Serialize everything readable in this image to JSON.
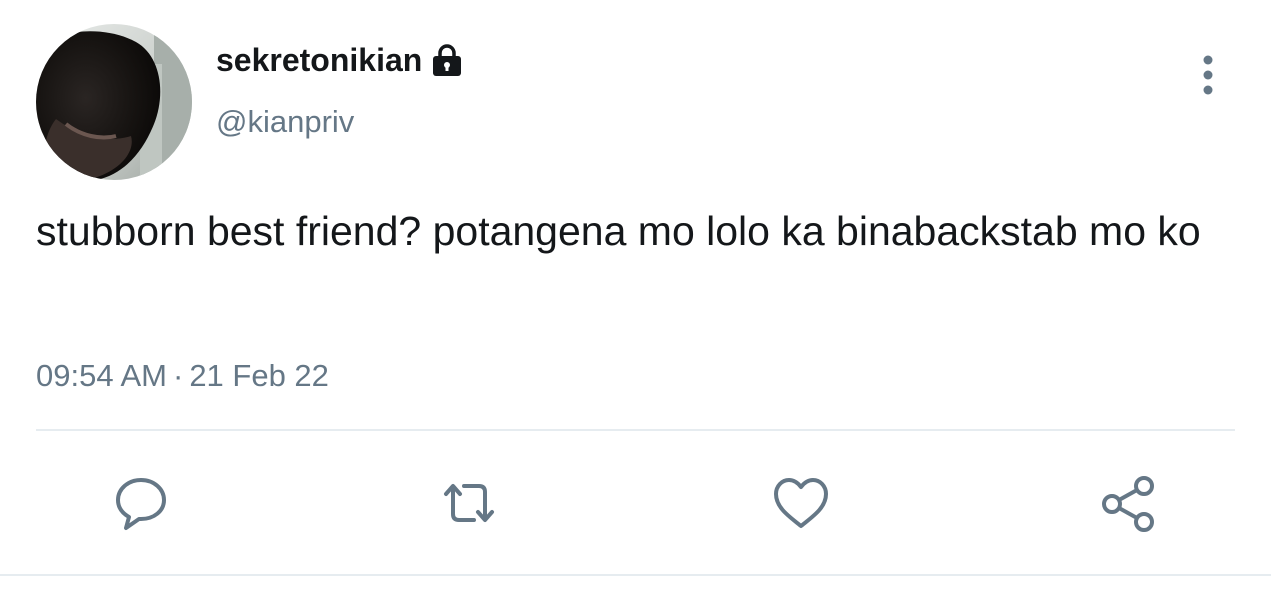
{
  "user": {
    "display_name": "sekretonikian",
    "handle": "@kianpriv",
    "protected_icon": "lock-icon",
    "avatar": "profile-photo"
  },
  "tweet": {
    "text": "stubborn best friend? potangena mo lolo ka binabackstab mo ko",
    "time": "09:54 AM",
    "separator": "·",
    "date": "21 Feb 22"
  },
  "actions": [
    {
      "name": "reply",
      "icon": "reply-icon"
    },
    {
      "name": "retweet",
      "icon": "retweet-icon"
    },
    {
      "name": "like",
      "icon": "heart-icon"
    },
    {
      "name": "share",
      "icon": "share-icon"
    }
  ],
  "more_menu": {
    "icon": "more-vertical-icon"
  },
  "colors": {
    "text": "#14171a",
    "secondary": "#657786",
    "divider": "#e6ecf0"
  }
}
